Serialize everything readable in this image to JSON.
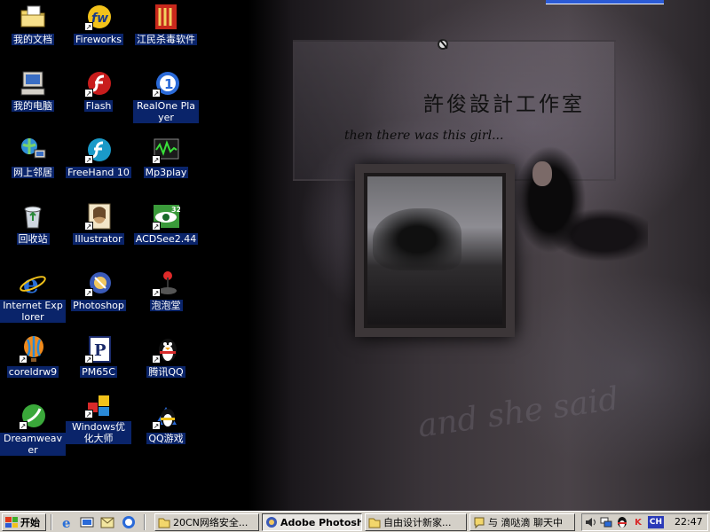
{
  "wallpaper": {
    "title": "許俊設計工作室",
    "subtitle": "then there was this girl...",
    "script_text": "and she said"
  },
  "desktop_icons": [
    {
      "id": "my-documents",
      "label": "我的文档",
      "icon": "folder-documents-icon",
      "shortcut": false
    },
    {
      "id": "my-computer",
      "label": "我的电脑",
      "icon": "computer-icon",
      "shortcut": false
    },
    {
      "id": "network-places",
      "label": "网上邻居",
      "icon": "network-icon",
      "shortcut": false
    },
    {
      "id": "recycle-bin",
      "label": "回收站",
      "icon": "recycle-bin-icon",
      "shortcut": false
    },
    {
      "id": "internet-explorer",
      "label": "Internet Explorer",
      "icon": "internet-explorer-icon",
      "shortcut": false
    },
    {
      "id": "coreldrw9",
      "label": "coreldrw9",
      "icon": "balloon-icon",
      "shortcut": true
    },
    {
      "id": "dreamweaver",
      "label": "Dreamweaver",
      "icon": "dreamweaver-icon",
      "shortcut": true
    },
    {
      "id": "fireworks",
      "label": "Fireworks",
      "icon": "fireworks-icon",
      "shortcut": true
    },
    {
      "id": "flash",
      "label": "Flash",
      "icon": "flash-icon",
      "shortcut": true
    },
    {
      "id": "freehand",
      "label": "FreeHand 10",
      "icon": "freehand-icon",
      "shortcut": true
    },
    {
      "id": "illustrator",
      "label": "Illustrator",
      "icon": "illustrator-icon",
      "shortcut": true
    },
    {
      "id": "photoshop",
      "label": "Photoshop",
      "icon": "photoshop-icon",
      "shortcut": true
    },
    {
      "id": "pm65c",
      "label": "PM65C",
      "icon": "pagemaker-icon",
      "shortcut": true
    },
    {
      "id": "windows-optimizer",
      "label": "Windows优化大师",
      "icon": "cubes-icon",
      "shortcut": true
    },
    {
      "id": "jiangmin-antivirus",
      "label": "江民杀毒软件",
      "icon": "antivirus-icon",
      "shortcut": false
    },
    {
      "id": "realone",
      "label": "RealOne Player",
      "icon": "realone-icon",
      "shortcut": true
    },
    {
      "id": "mp3play",
      "label": "Mp3play",
      "icon": "oscilloscope-icon",
      "shortcut": true
    },
    {
      "id": "acdsee",
      "label": "ACDSee2.44",
      "icon": "eye-icon",
      "shortcut": true
    },
    {
      "id": "paopaotang",
      "label": "泡泡堂",
      "icon": "joystick-icon",
      "shortcut": true
    },
    {
      "id": "qq",
      "label": "腾讯QQ",
      "icon": "penguin-icon",
      "shortcut": true
    },
    {
      "id": "qq-games",
      "label": "QQ游戏",
      "icon": "penguin-games-icon",
      "shortcut": true
    }
  ],
  "taskbar": {
    "start_label": "开始",
    "quicklaunch": [
      "ie-icon",
      "show-desktop-icon",
      "outlook-icon",
      "media-icon"
    ],
    "tasks": [
      {
        "label": "20CN网络安全...",
        "icon": "folder-icon",
        "active": false
      },
      {
        "label": "Adobe Photoshop",
        "icon": "photoshop-icon",
        "active": true
      },
      {
        "label": "自由设计新家...",
        "icon": "folder-icon",
        "active": false
      },
      {
        "label": "与 滴哒滴 聊天中",
        "icon": "qq-chat-icon",
        "active": false
      }
    ],
    "tray": {
      "icons": [
        "speaker-icon",
        "network-icon",
        "qq-tray-icon",
        "kingsoft-icon"
      ],
      "input_method": "CH",
      "clock": "22:47"
    }
  },
  "colors": {
    "selection": "#0a246a",
    "taskbar": "#d4d0c8",
    "start_flag": [
      "#e23a1c",
      "#3fae2a",
      "#2a5ad6",
      "#f2c21a"
    ]
  }
}
